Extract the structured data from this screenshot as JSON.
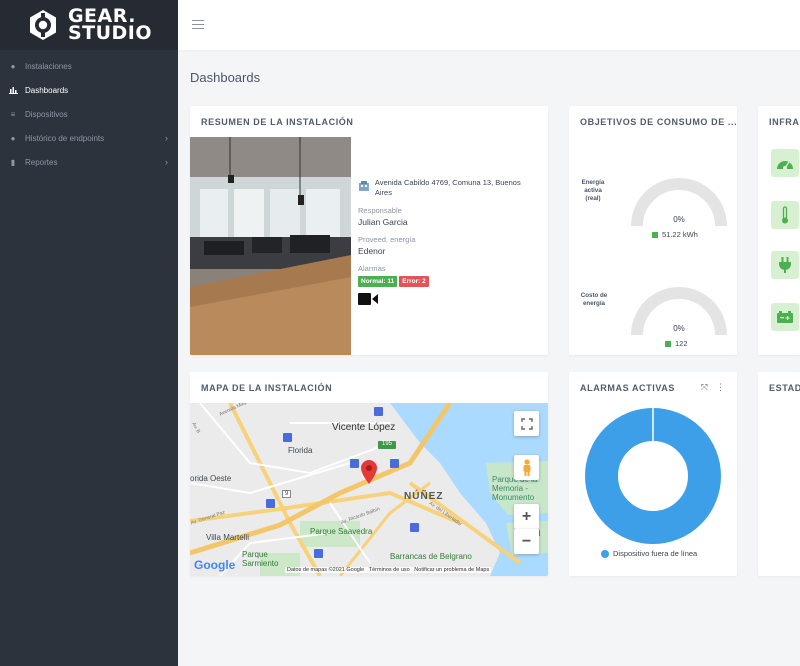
{
  "logo": {
    "line1": "GEAR.",
    "line2": "STUDIO"
  },
  "sidebar": {
    "items": [
      {
        "label": "Instalaciones",
        "icon": "globe-icon"
      },
      {
        "label": "Dashboards",
        "icon": "chart-icon",
        "active": true
      },
      {
        "label": "Dispositivos",
        "icon": "list-icon"
      },
      {
        "label": "Histórico de endpoints",
        "icon": "info-circle-icon"
      },
      {
        "label": "Reportes",
        "icon": "file-icon"
      }
    ]
  },
  "page_title": "Dashboards",
  "summary": {
    "title": "RESUMEN DE LA INSTALACIÓN",
    "address": "Avenida Cabildo 4769, Comuna 13, Buenos Aires",
    "responsable_label": "Responsable",
    "responsable": "Julian Garcia",
    "proveedor_label": "Proveed. energía",
    "proveedor": "Edenor",
    "alarmas_label": "Alarmas",
    "badge_normal": "Normal: 11",
    "badge_error": "Error: 2"
  },
  "objetivos": {
    "title": "OBJETIVOS DE CONSUMO DE ...",
    "gauges": [
      {
        "label": "Energía activa (real)",
        "percent": "0%",
        "value": 0,
        "legend": "51.22 kWh"
      },
      {
        "label": "Costo de energía",
        "percent": "0%",
        "value": 0,
        "legend": "122"
      }
    ]
  },
  "infra": {
    "title": "INFRAE",
    "icons": [
      "gauge-icon",
      "thermometer-icon",
      "plug-icon",
      "battery-icon"
    ]
  },
  "map_card": {
    "title": "MAPA DE LA INSTALACIÓN",
    "places": {
      "vicente_lopez": "Vicente López",
      "florida": "Florida",
      "florida_oeste": "orida Oeste",
      "nunez": "NÚÑEZ",
      "parque_saavedra": "Parque Saavedra",
      "villa_martelli": "Villa Martelli",
      "parque_sarmiento": "Parque Sarmiento",
      "barrancas": "Barrancas de Belgrano",
      "memoria": "Parque de la Memoria - Monumento",
      "route_195": "195",
      "route_9": "9",
      "av_maipu": "Avenida Maipú",
      "av_ricardo_balbin": "Av. Ricardo Balbín",
      "av_lib": "Av. del Libertador",
      "av_general_paz": "Av. General Paz",
      "av_b": "Av. B",
      "cubo": "d"
    },
    "google": "Google",
    "attribution": "Datos de mapas ©2021 Google",
    "terms": "Términos de uso",
    "report": "Notificar un problema de Maps"
  },
  "alarmas": {
    "title": "ALARMAS ACTIVAS",
    "legend": "Dispositivo fuera de línea",
    "chart_data": {
      "type": "pie",
      "categories": [
        "Dispositivo fuera de línea"
      ],
      "values": [
        100
      ]
    },
    "color": "#3d9fe8"
  },
  "estado": {
    "title": "ESTAD"
  },
  "colors": {
    "sidebar": "#2d333d",
    "green": "#4caf50",
    "red": "#e05656",
    "blue": "#3d9fe8"
  }
}
